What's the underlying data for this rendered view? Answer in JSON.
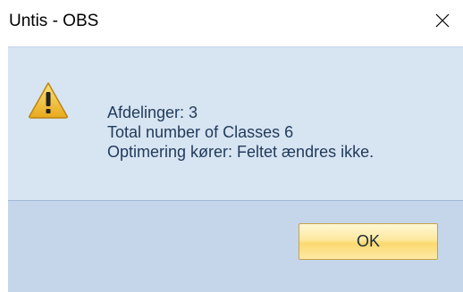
{
  "window": {
    "title": "Untis - OBS",
    "close_icon": "close-icon"
  },
  "message": {
    "icon": "warning-icon",
    "lines": [
      "Afdelinger: 3",
      "Total number of Classes 6",
      "Optimering kører: Feltet ændres ikke."
    ]
  },
  "buttons": {
    "ok_label": "OK"
  },
  "colors": {
    "content_bg": "#d7e4f2",
    "footer_bg": "#c5d6eb",
    "message_text": "#1f3a5a",
    "button_gradient_top": "#fff7d6",
    "button_gradient_mid": "#fbd970",
    "button_border": "#c5a24a",
    "warning_yellow": "#f5c842"
  }
}
